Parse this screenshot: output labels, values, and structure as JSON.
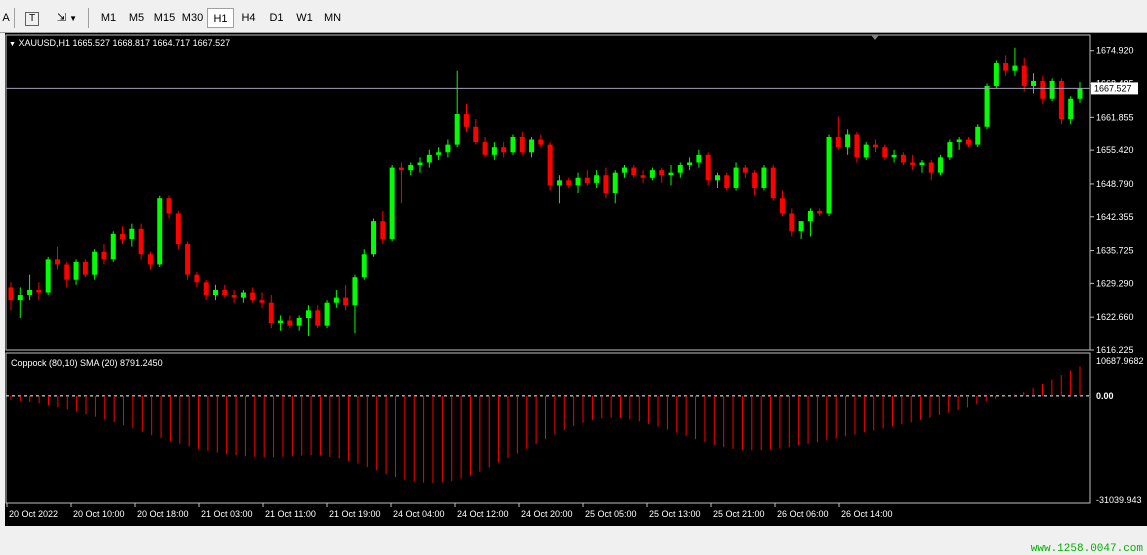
{
  "toolbar": {
    "tool_a_label": "A",
    "tool_t_label": "T",
    "timeframes": [
      "M1",
      "M5",
      "M15",
      "M30",
      "H1",
      "H4",
      "D1",
      "W1",
      "MN"
    ],
    "active_timeframe": "H1"
  },
  "chart": {
    "header": "XAUUSD,H1  1665.527 1668.817 1664.717 1667.527",
    "current_price_label": "1667.527",
    "price_axis_labels": [
      "1674.920",
      "1668.485",
      "1661.855",
      "1655.420",
      "1648.790",
      "1642.355",
      "1635.725",
      "1629.290",
      "1622.660",
      "1616.225"
    ],
    "time_axis_labels": [
      "20 Oct 2022",
      "20 Oct 10:00",
      "20 Oct 18:00",
      "21 Oct 03:00",
      "21 Oct 11:00",
      "21 Oct 19:00",
      "24 Oct 04:00",
      "24 Oct 12:00",
      "24 Oct 20:00",
      "25 Oct 05:00",
      "25 Oct 13:00",
      "25 Oct 21:00",
      "26 Oct 06:00",
      "26 Oct 14:00"
    ],
    "bull_color": "#00ff00",
    "bear_color": "#ff0000"
  },
  "indicator": {
    "header": "Coppock (80,10) SMA (20)  8791.2450",
    "axis_labels": [
      "10687.9682",
      "0.00",
      "-31039.943"
    ],
    "color": "#ff0000",
    "zero_line_color": "#ffffff"
  },
  "watermark": "www.1258.0047.com",
  "chart_data": {
    "type": "candlestick",
    "symbol": "XAUUSD",
    "timeframe": "H1",
    "ylim": [
      1616.225,
      1678.0
    ],
    "current_price": 1667.527,
    "candles": [
      [
        1628.5,
        1629.5,
        1624.0,
        1626.0
      ],
      [
        1626.0,
        1628.5,
        1622.5,
        1627.0
      ],
      [
        1627.0,
        1631.0,
        1626.0,
        1628.0
      ],
      [
        1628.0,
        1629.5,
        1626.0,
        1627.5
      ],
      [
        1627.5,
        1634.5,
        1627.0,
        1634.0
      ],
      [
        1634.0,
        1636.5,
        1632.0,
        1633.0
      ],
      [
        1633.0,
        1633.5,
        1628.5,
        1630.0
      ],
      [
        1630.0,
        1634.0,
        1629.0,
        1633.5
      ],
      [
        1633.5,
        1634.0,
        1630.5,
        1631.0
      ],
      [
        1631.0,
        1636.0,
        1630.0,
        1635.5
      ],
      [
        1635.5,
        1637.0,
        1633.0,
        1634.0
      ],
      [
        1634.0,
        1639.5,
        1633.5,
        1639.0
      ],
      [
        1639.0,
        1640.5,
        1637.0,
        1638.0
      ],
      [
        1638.0,
        1641.0,
        1636.5,
        1640.0
      ],
      [
        1640.0,
        1641.0,
        1634.0,
        1635.0
      ],
      [
        1635.0,
        1635.5,
        1632.0,
        1633.0
      ],
      [
        1633.0,
        1646.5,
        1632.5,
        1646.0
      ],
      [
        1646.0,
        1646.5,
        1642.0,
        1643.0
      ],
      [
        1643.0,
        1643.5,
        1636.0,
        1637.0
      ],
      [
        1637.0,
        1637.5,
        1630.0,
        1631.0
      ],
      [
        1631.0,
        1631.5,
        1628.5,
        1629.5
      ],
      [
        1629.5,
        1630.0,
        1626.0,
        1627.0
      ],
      [
        1627.0,
        1629.0,
        1626.0,
        1628.0
      ],
      [
        1628.0,
        1629.0,
        1626.5,
        1627.0
      ],
      [
        1627.0,
        1628.0,
        1625.5,
        1626.5
      ],
      [
        1626.5,
        1628.0,
        1625.5,
        1627.5
      ],
      [
        1627.5,
        1628.5,
        1625.5,
        1626.0
      ],
      [
        1626.0,
        1627.5,
        1624.5,
        1625.5
      ],
      [
        1625.5,
        1627.0,
        1620.5,
        1621.5
      ],
      [
        1621.5,
        1623.0,
        1620.0,
        1622.0
      ],
      [
        1622.0,
        1623.0,
        1620.5,
        1621.0
      ],
      [
        1621.0,
        1623.0,
        1620.0,
        1622.5
      ],
      [
        1622.5,
        1625.0,
        1619.0,
        1624.0
      ],
      [
        1624.0,
        1625.0,
        1620.5,
        1621.0
      ],
      [
        1621.0,
        1626.0,
        1620.5,
        1625.5
      ],
      [
        1625.5,
        1628.0,
        1624.5,
        1626.5
      ],
      [
        1626.5,
        1629.0,
        1624.0,
        1625.0
      ],
      [
        1625.0,
        1631.0,
        1619.5,
        1630.5
      ],
      [
        1630.5,
        1636.0,
        1630.0,
        1635.0
      ],
      [
        1635.0,
        1642.0,
        1634.5,
        1641.5
      ],
      [
        1641.5,
        1643.5,
        1637.0,
        1638.0
      ],
      [
        1638.0,
        1652.5,
        1637.5,
        1652.0
      ],
      [
        1652.0,
        1653.0,
        1645.0,
        1651.5
      ],
      [
        1651.5,
        1653.0,
        1650.5,
        1652.5
      ],
      [
        1652.5,
        1654.0,
        1651.0,
        1653.0
      ],
      [
        1653.0,
        1655.5,
        1652.0,
        1654.5
      ],
      [
        1654.5,
        1656.0,
        1653.5,
        1655.0
      ],
      [
        1655.0,
        1657.5,
        1654.0,
        1656.5
      ],
      [
        1656.5,
        1671.0,
        1656.0,
        1662.5
      ],
      [
        1662.5,
        1664.5,
        1659.0,
        1660.0
      ],
      [
        1660.0,
        1661.5,
        1656.5,
        1657.0
      ],
      [
        1657.0,
        1658.0,
        1654.0,
        1654.5
      ],
      [
        1654.5,
        1657.0,
        1653.5,
        1656.0
      ],
      [
        1656.0,
        1657.0,
        1654.0,
        1655.0
      ],
      [
        1655.0,
        1658.5,
        1654.5,
        1658.0
      ],
      [
        1658.0,
        1659.0,
        1654.5,
        1655.0
      ],
      [
        1655.0,
        1658.0,
        1654.0,
        1657.5
      ],
      [
        1657.5,
        1658.5,
        1656.0,
        1656.5
      ],
      [
        1656.5,
        1657.0,
        1647.5,
        1648.5
      ],
      [
        1648.5,
        1650.5,
        1645.0,
        1649.5
      ],
      [
        1649.5,
        1650.0,
        1648.0,
        1648.5
      ],
      [
        1648.5,
        1651.0,
        1647.0,
        1650.0
      ],
      [
        1650.0,
        1651.5,
        1648.5,
        1649.0
      ],
      [
        1649.0,
        1651.5,
        1648.0,
        1650.5
      ],
      [
        1650.5,
        1652.0,
        1646.0,
        1647.0
      ],
      [
        1647.0,
        1651.5,
        1645.0,
        1651.0
      ],
      [
        1651.0,
        1652.5,
        1650.0,
        1652.0
      ],
      [
        1652.0,
        1652.5,
        1650.0,
        1650.5
      ],
      [
        1650.5,
        1651.5,
        1649.0,
        1650.0
      ],
      [
        1650.0,
        1652.0,
        1649.5,
        1651.5
      ],
      [
        1651.5,
        1652.0,
        1649.0,
        1650.5
      ],
      [
        1650.5,
        1652.5,
        1648.5,
        1651.0
      ],
      [
        1651.0,
        1653.0,
        1650.0,
        1652.5
      ],
      [
        1652.5,
        1654.0,
        1651.5,
        1653.0
      ],
      [
        1653.0,
        1655.5,
        1652.0,
        1654.5
      ],
      [
        1654.5,
        1655.0,
        1648.5,
        1649.5
      ],
      [
        1649.5,
        1651.0,
        1648.0,
        1650.5
      ],
      [
        1650.5,
        1651.0,
        1647.5,
        1648.0
      ],
      [
        1648.0,
        1653.0,
        1647.5,
        1652.0
      ],
      [
        1652.0,
        1652.5,
        1650.0,
        1651.0
      ],
      [
        1651.0,
        1651.5,
        1646.5,
        1648.0
      ],
      [
        1648.0,
        1652.5,
        1647.5,
        1652.0
      ],
      [
        1652.0,
        1652.5,
        1645.5,
        1646.0
      ],
      [
        1646.0,
        1647.5,
        1642.5,
        1643.0
      ],
      [
        1643.0,
        1644.0,
        1638.5,
        1639.5
      ],
      [
        1639.5,
        1640.5,
        1638.0,
        1641.5
      ],
      [
        1641.5,
        1644.0,
        1638.5,
        1643.5
      ],
      [
        1643.5,
        1644.0,
        1642.5,
        1643.0
      ],
      [
        1643.0,
        1658.5,
        1642.5,
        1658.0
      ],
      [
        1658.0,
        1662.0,
        1655.5,
        1656.0
      ],
      [
        1656.0,
        1659.5,
        1654.5,
        1658.5
      ],
      [
        1658.5,
        1659.0,
        1653.0,
        1654.0
      ],
      [
        1654.0,
        1657.0,
        1653.5,
        1656.5
      ],
      [
        1656.5,
        1657.5,
        1655.0,
        1656.0
      ],
      [
        1656.0,
        1656.5,
        1653.5,
        1654.0
      ],
      [
        1654.0,
        1655.5,
        1653.0,
        1654.5
      ],
      [
        1654.5,
        1655.0,
        1652.5,
        1653.0
      ],
      [
        1653.0,
        1654.5,
        1651.5,
        1652.5
      ],
      [
        1652.5,
        1653.5,
        1651.0,
        1653.0
      ],
      [
        1653.0,
        1653.5,
        1649.5,
        1651.0
      ],
      [
        1651.0,
        1654.5,
        1650.5,
        1654.0
      ],
      [
        1654.0,
        1657.5,
        1653.5,
        1657.0
      ],
      [
        1657.0,
        1658.0,
        1655.5,
        1657.5
      ],
      [
        1657.5,
        1658.0,
        1656.0,
        1656.5
      ],
      [
        1656.5,
        1660.5,
        1656.0,
        1660.0
      ],
      [
        1660.0,
        1668.5,
        1659.5,
        1668.0
      ],
      [
        1668.0,
        1673.0,
        1667.5,
        1672.5
      ],
      [
        1672.5,
        1674.0,
        1670.0,
        1671.0
      ],
      [
        1671.0,
        1675.5,
        1670.0,
        1672.0
      ],
      [
        1672.0,
        1673.5,
        1667.0,
        1668.0
      ],
      [
        1668.0,
        1670.5,
        1666.5,
        1669.0
      ],
      [
        1669.0,
        1670.0,
        1664.5,
        1665.5
      ],
      [
        1665.5,
        1669.5,
        1665.0,
        1669.0
      ],
      [
        1669.0,
        1669.5,
        1660.5,
        1661.5
      ],
      [
        1661.5,
        1666.0,
        1660.5,
        1665.5
      ],
      [
        1665.5,
        1668.8,
        1664.7,
        1667.5
      ]
    ],
    "oscillator": {
      "name": "Coppock (80,10) SMA (20)",
      "last_value": 8791.245,
      "ylim": [
        -31039.943,
        10687.9682
      ],
      "values": [
        -1200,
        -1500,
        -1800,
        -2200,
        -2800,
        -3400,
        -4000,
        -4700,
        -5400,
        -6200,
        -7000,
        -7800,
        -8800,
        -9700,
        -10700,
        -11700,
        -12600,
        -13500,
        -14300,
        -15100,
        -15800,
        -16400,
        -16900,
        -17400,
        -17700,
        -18000,
        -18200,
        -18300,
        -18300,
        -18200,
        -18000,
        -17800,
        -17700,
        -17800,
        -18200,
        -18700,
        -19400,
        -20200,
        -21200,
        -22200,
        -23300,
        -24200,
        -25000,
        -25600,
        -25900,
        -26000,
        -25800,
        -25400,
        -24700,
        -23700,
        -22600,
        -21300,
        -19900,
        -18500,
        -17200,
        -15800,
        -14400,
        -12900,
        -11500,
        -10200,
        -9000,
        -8000,
        -7200,
        -6700,
        -6500,
        -6600,
        -7000,
        -7600,
        -8400,
        -9200,
        -10100,
        -11000,
        -11900,
        -12900,
        -13800,
        -14600,
        -15300,
        -15800,
        -16100,
        -16200,
        -16200,
        -16000,
        -15700,
        -15300,
        -14800,
        -14300,
        -13800,
        -13300,
        -12700,
        -12100,
        -11500,
        -10900,
        -10300,
        -9700,
        -9100,
        -8500,
        -7900,
        -7200,
        -6500,
        -5700,
        -5000,
        -4200,
        -3400,
        -2500,
        -1700,
        -900,
        -200,
        400,
        1200,
        2300,
        3500,
        4800,
        6200,
        7600,
        8791
      ]
    }
  }
}
